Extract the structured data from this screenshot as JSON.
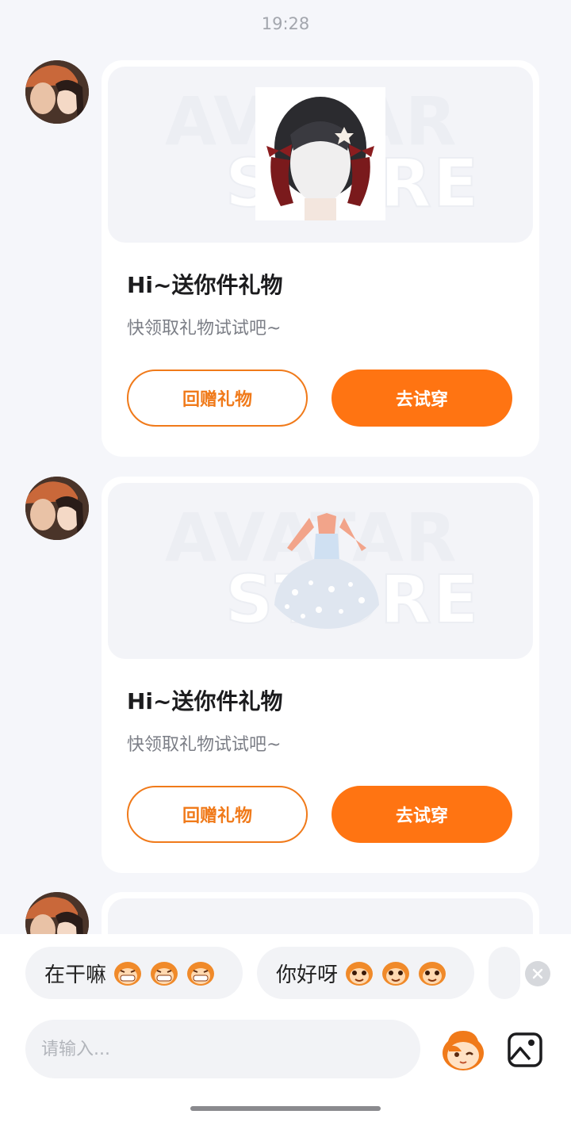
{
  "status": {
    "time": "19:28"
  },
  "messages": [
    {
      "title": "Hi~送你件礼物",
      "subtitle": "快领取礼物试试吧~",
      "return_label": "回赠礼物",
      "try_label": "去试穿",
      "gift_icon": "hair-accessory",
      "watermark": [
        "AVATAR",
        "STORE"
      ]
    },
    {
      "title": "Hi~送你件礼物",
      "subtitle": "快领取礼物试试吧~",
      "return_label": "回赠礼物",
      "try_label": "去试穿",
      "gift_icon": "dress",
      "watermark": [
        "AVATAR",
        "STORE"
      ]
    }
  ],
  "quick_replies": [
    {
      "text": "在干嘛",
      "emoji": "grinning-monkey-face"
    },
    {
      "text": "你好呀",
      "emoji": "happy-monkey-face"
    }
  ],
  "composer": {
    "placeholder": "请输入...",
    "sticker_icon": "monkey-sticker-icon",
    "image_icon": "image-icon",
    "close_icon": "close-icon"
  },
  "colors": {
    "accent": "#ff7412",
    "background": "#f5f6fa"
  }
}
